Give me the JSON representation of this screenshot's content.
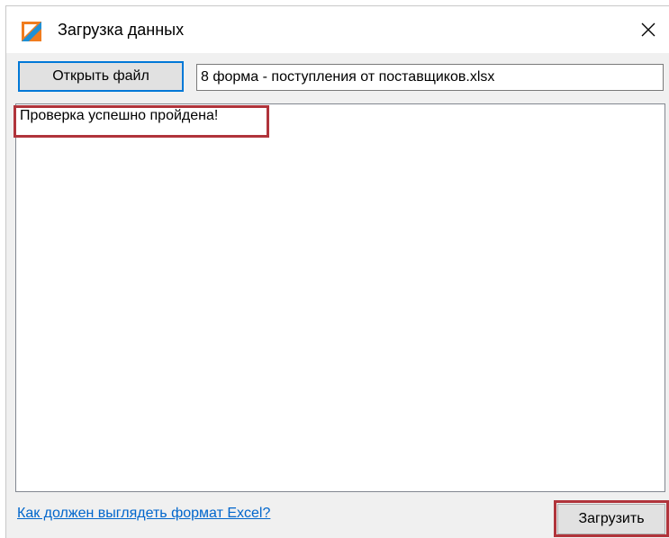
{
  "window": {
    "title": "Загрузка данных",
    "app_icon": "app-logo-icon",
    "close_icon": "close-icon"
  },
  "toolbar": {
    "open_file_label": "Открыть файл",
    "file_path_value": "8 форма - поступления от поставщиков.xlsx"
  },
  "log": {
    "lines": [
      "Проверка успешно пройдена!"
    ]
  },
  "footer": {
    "help_link_label": "Как должен выглядеть формат Excel?",
    "load_button_label": "Загрузить"
  },
  "colors": {
    "accent": "#0078d7",
    "highlight": "#b0343b",
    "link": "#0066cc",
    "icon_orange": "#f07c1e",
    "icon_blue": "#1e90d6"
  }
}
